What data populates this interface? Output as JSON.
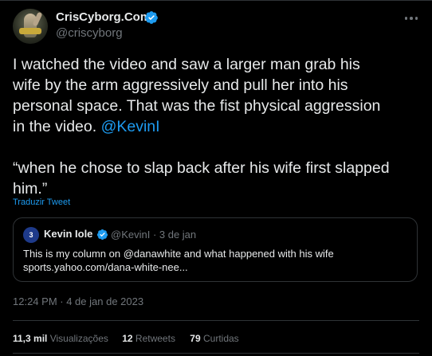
{
  "author": {
    "display_name": "CrisCyborg.Com",
    "handle": "@criscyborg",
    "verified": true
  },
  "tweet": {
    "text_1a": "I watched the video and saw a larger man grab his",
    "text_1b": "wife by the arm aggressively and pull her into his",
    "text_1c": "personal space. That was the fist physical aggression",
    "text_1d": "in the video. ",
    "mention": "@KevinI",
    "text_2a": "“when he chose to slap back after his wife first slapped",
    "text_2b": "him.”",
    "translate_label": "Traduzir Tweet"
  },
  "quote": {
    "avatar_text": "3",
    "display_name": "Kevin Iole",
    "meta": "@KevinI · 3 de jan",
    "line1": "This is my column on @danawhite and what happened with his wife",
    "line2": "sports.yahoo.com/dana-white-nee..."
  },
  "timestamp": {
    "time": "12:24 PM",
    "sep": " · ",
    "date": "4 de jan de 2023"
  },
  "stats": {
    "views_count": "11,3 mil",
    "views_label": "Visualizações",
    "retweets_count": "12",
    "retweets_label": "Retweets",
    "likes_count": "79",
    "likes_label": "Curtidas"
  },
  "colors": {
    "background": "#000000",
    "text": "#e7e9ea",
    "muted": "#71767b",
    "accent": "#1d9bf0",
    "border": "#2f3336"
  },
  "icons": {
    "verified": "verified-badge-icon",
    "more": "more-options-icon"
  }
}
